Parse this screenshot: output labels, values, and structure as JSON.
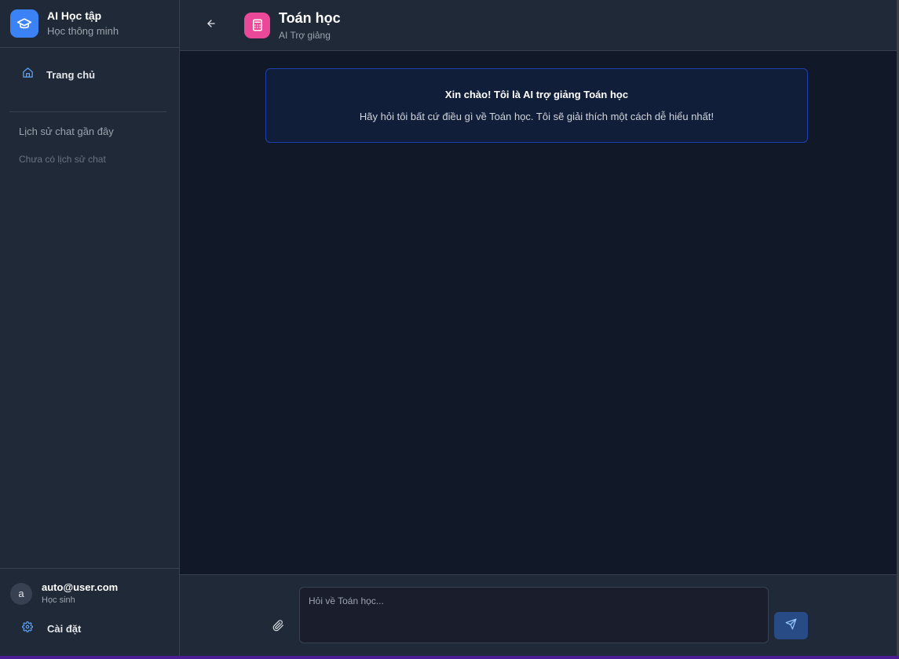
{
  "sidebar": {
    "brand": {
      "title": "AI Học tập",
      "subtitle": "Học thông minh",
      "icon": "graduation-cap-icon"
    },
    "nav": [
      {
        "label": "Trang chủ",
        "icon": "home-icon"
      }
    ],
    "history": {
      "title": "Lịch sử chat gần đây",
      "empty": "Chưa có lịch sử chat"
    },
    "user": {
      "avatar_letter": "a",
      "email": "auto@user.com",
      "role": "Học sinh"
    },
    "settings": {
      "label": "Cài đặt",
      "icon": "gear-icon"
    }
  },
  "header": {
    "back_icon": "arrow-left-icon",
    "subject_icon": "calculator-icon",
    "title": "Toán học",
    "subtitle": "AI Trợ giảng"
  },
  "chat": {
    "welcome_title": "Xin chào! Tôi là AI trợ giảng Toán học",
    "welcome_text": "Hãy hỏi tôi bất cứ điều gì về Toán học. Tôi sẽ giải thích một cách dễ hiểu nhất!"
  },
  "composer": {
    "placeholder": "Hỏi về Toán học...",
    "value": "",
    "attach_icon": "paperclip-icon",
    "send_icon": "send-icon"
  },
  "colors": {
    "accent": "#3b82f6",
    "subject": "#ec4899",
    "background": "#111827",
    "panel": "#1f2937"
  }
}
